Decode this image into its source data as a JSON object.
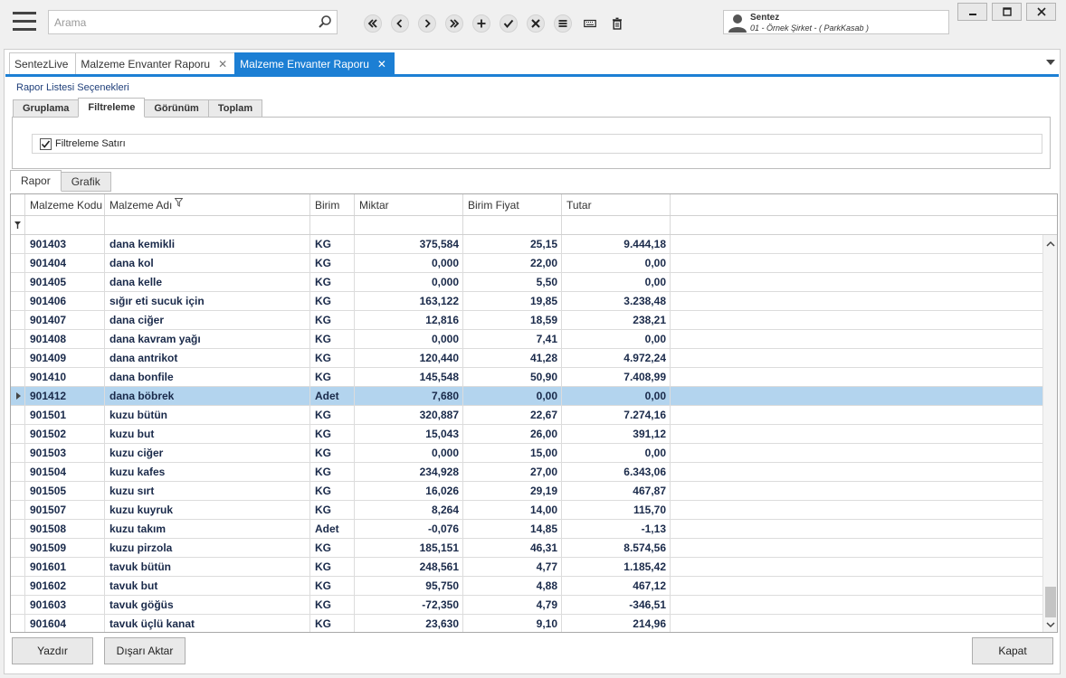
{
  "search": {
    "placeholder": "Arama"
  },
  "toolbar": {
    "buttons": [
      "first-icon",
      "prev-icon",
      "next-icon",
      "last-icon",
      "add-icon",
      "check-icon",
      "delete-x-icon",
      "list-icon",
      "keyboard-icon",
      "trash-icon"
    ]
  },
  "user": {
    "name": "Sentez",
    "company": "01 - Örnek Şirket - ( ParkKasab )"
  },
  "doc_tabs": [
    {
      "label": "SentezLive",
      "closable": false,
      "active": false
    },
    {
      "label": "Malzeme Envanter Raporu",
      "closable": true,
      "active": false
    },
    {
      "label": "Malzeme Envanter Raporu",
      "closable": true,
      "active": true
    }
  ],
  "report_options": {
    "title": "Rapor Listesi Seçenekleri",
    "tabs": [
      "Gruplama",
      "Filtreleme",
      "Görünüm",
      "Toplam"
    ],
    "active_tab": "Filtreleme",
    "filter_row_label": "Filtreleme Satırı",
    "filter_row_checked": true
  },
  "report_tabs": [
    "Rapor",
    "Grafik"
  ],
  "grid": {
    "columns": [
      "Malzeme Kodu",
      "Malzeme Adı",
      "Birim",
      "Miktar",
      "Birim Fiyat",
      "Tutar"
    ],
    "selected_row": 8,
    "rows": [
      [
        "901403",
        "dana kemikli",
        "KG",
        "375,584",
        "25,15",
        "9.444,18"
      ],
      [
        "901404",
        "dana kol",
        "KG",
        "0,000",
        "22,00",
        "0,00"
      ],
      [
        "901405",
        "dana kelle",
        "KG",
        "0,000",
        "5,50",
        "0,00"
      ],
      [
        "901406",
        "sığır eti sucuk için",
        "KG",
        "163,122",
        "19,85",
        "3.238,48"
      ],
      [
        "901407",
        "dana ciğer",
        "KG",
        "12,816",
        "18,59",
        "238,21"
      ],
      [
        "901408",
        "dana kavram yağı",
        "KG",
        "0,000",
        "7,41",
        "0,00"
      ],
      [
        "901409",
        "dana antrikot",
        "KG",
        "120,440",
        "41,28",
        "4.972,24"
      ],
      [
        "901410",
        "dana bonfile",
        "KG",
        "145,548",
        "50,90",
        "7.408,99"
      ],
      [
        "901412",
        "dana böbrek",
        "Adet",
        "7,680",
        "0,00",
        "0,00"
      ],
      [
        "901501",
        "kuzu bütün",
        "KG",
        "320,887",
        "22,67",
        "7.274,16"
      ],
      [
        "901502",
        "kuzu but",
        "KG",
        "15,043",
        "26,00",
        "391,12"
      ],
      [
        "901503",
        "kuzu ciğer",
        "KG",
        "0,000",
        "15,00",
        "0,00"
      ],
      [
        "901504",
        "kuzu kafes",
        "KG",
        "234,928",
        "27,00",
        "6.343,06"
      ],
      [
        "901505",
        "kuzu sırt",
        "KG",
        "16,026",
        "29,19",
        "467,87"
      ],
      [
        "901507",
        "kuzu kuyruk",
        "KG",
        "8,264",
        "14,00",
        "115,70"
      ],
      [
        "901508",
        "kuzu takım",
        "Adet",
        "-0,076",
        "14,85",
        "-1,13"
      ],
      [
        "901509",
        "kuzu pirzola",
        "KG",
        "185,151",
        "46,31",
        "8.574,56"
      ],
      [
        "901601",
        "tavuk bütün",
        "KG",
        "248,561",
        "4,77",
        "1.185,42"
      ],
      [
        "901602",
        "tavuk but",
        "KG",
        "95,750",
        "4,88",
        "467,12"
      ],
      [
        "901603",
        "tavuk göğüs",
        "KG",
        "-72,350",
        "4,79",
        "-346,51"
      ],
      [
        "901604",
        "tavuk üçlü kanat",
        "KG",
        "23,630",
        "9,10",
        "214,96"
      ]
    ]
  },
  "footer": {
    "print_label": "Yazdır",
    "export_label": "Dışarı Aktar",
    "close_label": "Kapat"
  },
  "colors": {
    "accent": "#1c7fd4",
    "selected_row": "#b3d4ee",
    "text": "#1a2a4a"
  }
}
